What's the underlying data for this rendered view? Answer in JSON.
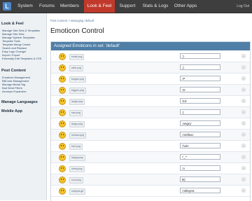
{
  "nav": {
    "logo": "L",
    "items": [
      "System",
      "Forums",
      "Members",
      "Look & Feel",
      "Support",
      "Stats & Logs",
      "Other Apps"
    ],
    "active_index": 3,
    "user": "Log Out"
  },
  "sidebar": {
    "look_feel_title": "Look & Feel",
    "look_feel_links": [
      "Manage Skin Sets & Templates",
      "Manage Skin Sets",
      "Manage System Templates",
      "Template Tools",
      "Template Merge Center",
      "Search and Replace",
      "Easy Logo Changer",
      "Import / Export",
      "Externally Edit Templates & CSS"
    ],
    "post_content_title": "Post Content",
    "post_content_links": [
      "Emoticon Management",
      "BBCode Management",
      "Manage Media Tag",
      "Bad Word Filters",
      "Acronym Expansion"
    ],
    "languages_title": "Manage Languages",
    "mobile_title": "Mobile App"
  },
  "breadcrumb": "Post Content  >  Managing 'default'",
  "page_title": "Emoticon Control",
  "panel_title": "Assigned Emoticons in set: 'default'",
  "emoticons": [
    {
      "file": "smile.png",
      "code": ":)"
    },
    {
      "file": "wink.png",
      "code": ";)"
    },
    {
      "file": "tongue.png",
      "code": ":P"
    },
    {
      "file": "biggrin.png",
      "code": ":D"
    },
    {
      "file": "laugh.png",
      "code": ":lol:"
    },
    {
      "file": "sad.png",
      "code": ":("
    },
    {
      "file": "angry.png",
      "code": ":angry:"
    },
    {
      "file": "mellow.png",
      "code": ":mellow:"
    },
    {
      "file": "huh.png",
      "code": ":huh:"
    },
    {
      "file": "happy.png",
      "code": "^_^"
    },
    {
      "file": "ohmy.png",
      "code": ":o"
    },
    {
      "file": "cool.png",
      "code": "B)"
    },
    {
      "file": "rolleyes.gif",
      "code": ":rolleyes:"
    }
  ]
}
